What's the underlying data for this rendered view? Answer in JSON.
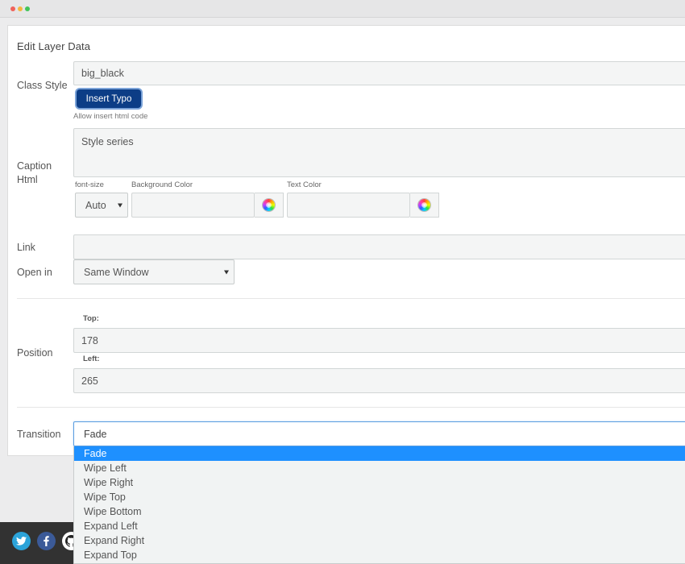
{
  "window": {
    "controls": [
      "close",
      "minimize",
      "maximize"
    ]
  },
  "panel": {
    "title": "Edit Layer Data"
  },
  "class_style": {
    "label": "Class Style",
    "value": "big_black",
    "insert_button": "Insert Typo",
    "help": "Allow insert html code"
  },
  "caption": {
    "label_line1": "Caption",
    "label_line2": "Html",
    "value": "Style series",
    "font_size_label": "font-size",
    "font_size_value": "Auto",
    "bg_color_label": "Background Color",
    "bg_color_value": "",
    "text_color_label": "Text Color",
    "text_color_value": ""
  },
  "link": {
    "label": "Link",
    "value": ""
  },
  "open_in": {
    "label": "Open in",
    "value": "Same Window"
  },
  "position": {
    "label": "Position",
    "top_label": "Top:",
    "top_value": "178",
    "left_label": "Left:",
    "left_value": "265"
  },
  "transition": {
    "label": "Transition",
    "value": "Fade",
    "options": [
      "Fade",
      "Wipe Left",
      "Wipe Right",
      "Wipe Top",
      "Wipe Bottom",
      "Expand Left",
      "Expand Right",
      "Expand Top"
    ],
    "selected_index": 0
  },
  "footer": {
    "social_icons": [
      "twitter-icon",
      "facebook-icon",
      "github-icon"
    ]
  },
  "colors": {
    "accent": "#0c3d86",
    "selection": "#1e90ff",
    "footer": "#323232"
  }
}
